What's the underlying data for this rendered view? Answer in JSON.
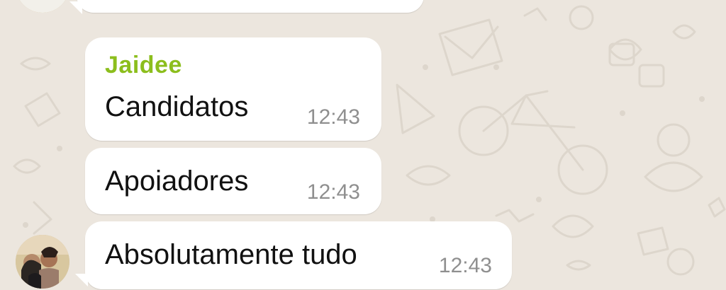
{
  "chat": {
    "messages": [
      {
        "sender": "Jaidee",
        "text": "Candidatos",
        "time": "12:43"
      },
      {
        "text": "Apoiadores",
        "time": "12:43"
      },
      {
        "text": "Absolutamente tudo",
        "time": "12:43"
      }
    ]
  },
  "colors": {
    "background": "#ece6de",
    "bubble": "#ffffff",
    "sender_name": "#8cbe1d",
    "message_text": "#111111",
    "timestamp": "#8f8f8f"
  }
}
